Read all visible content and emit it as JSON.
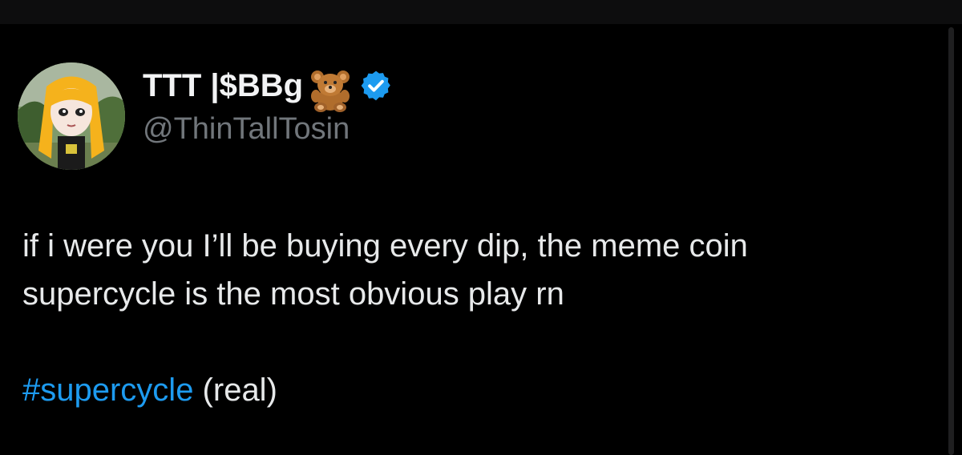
{
  "tweet": {
    "author": {
      "display_name": "TTT |$BBg",
      "emoji_icon": "teddy-bear-icon",
      "verified_icon": "verified-badge-icon",
      "handle": "@ThinTallTosin"
    },
    "text_lines": [
      "if i were you I’ll be buying every dip, the meme coin",
      "supercycle is the most obvious play rn"
    ],
    "hashtag": "#supercycle",
    "hashtag_suffix": " (real)"
  },
  "colors": {
    "background": "#000000",
    "text": "#e7e9ea",
    "handle": "#71767b",
    "link": "#1d9bf0",
    "verified": "#1d9bf0"
  }
}
